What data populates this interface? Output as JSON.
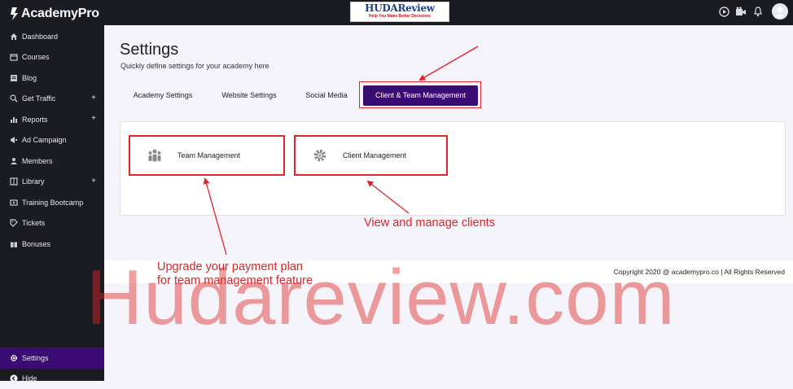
{
  "app": {
    "name": "AcademyPro"
  },
  "header": {
    "brand_main": "HUDA",
    "brand_accent": "Review",
    "brand_tagline": "Help You Make Better Decisions"
  },
  "sidebar": {
    "items": [
      {
        "label": "Dashboard",
        "icon": "home-icon"
      },
      {
        "label": "Courses",
        "icon": "box-icon"
      },
      {
        "label": "Blog",
        "icon": "blog-icon"
      },
      {
        "label": "Get Traffic",
        "icon": "traffic-icon",
        "expandable": true
      },
      {
        "label": "Reports",
        "icon": "reports-icon",
        "expandable": true
      },
      {
        "label": "Ad Campaign",
        "icon": "megaphone-icon"
      },
      {
        "label": "Members",
        "icon": "members-icon"
      },
      {
        "label": "Library",
        "icon": "library-icon",
        "expandable": true
      },
      {
        "label": "Training Bootcamp",
        "icon": "bootcamp-icon"
      },
      {
        "label": "Tickets",
        "icon": "ticket-icon"
      },
      {
        "label": "Bonuses",
        "icon": "gift-icon"
      }
    ],
    "settings_label": "Settings",
    "hide_label": "Hide",
    "plus": "+"
  },
  "page": {
    "title": "Settings",
    "subtitle": "Quickly define settings for your academy here",
    "tabs": [
      {
        "label": "Academy Settings"
      },
      {
        "label": "Website Settings"
      },
      {
        "label": "Social Media"
      },
      {
        "label": "Client & Team Management",
        "active": true
      }
    ],
    "cards": [
      {
        "label": "Team Management",
        "icon": "team-icon"
      },
      {
        "label": "Client Management",
        "icon": "gear-icon"
      }
    ]
  },
  "annotations": {
    "clients": "View and manage clients",
    "upgrade_line1": "Upgrade your payment plan",
    "upgrade_line2": "for team management feature"
  },
  "footer": {
    "copyright": "Copyright 2020 @ academypro.co | All Rights Reserved"
  },
  "watermark": "Hudareview.com",
  "colors": {
    "sidebar_bg": "#1b1c22",
    "accent_purple": "#3a0c73",
    "annotation_red": "#e0262c"
  }
}
